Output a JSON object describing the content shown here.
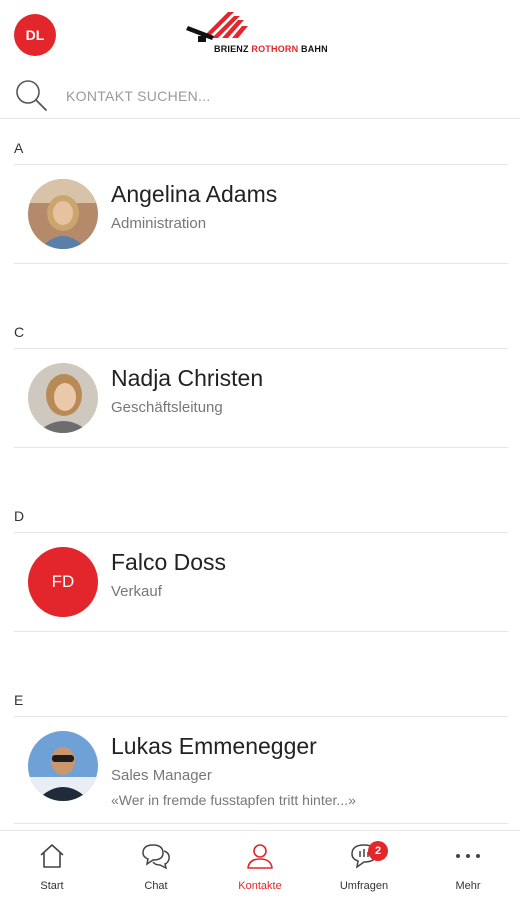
{
  "header": {
    "user_initials": "DL",
    "logo": {
      "part1": "BRIENZ ",
      "part2": "ROTHORN",
      "part3": " BAHN"
    }
  },
  "search": {
    "placeholder": "KONTAKT SUCHEN..."
  },
  "sections": [
    {
      "letter": "A",
      "contact": {
        "name": "Angelina Adams",
        "role": "Administration",
        "status": ""
      }
    },
    {
      "letter": "C",
      "contact": {
        "name": "Nadja Christen",
        "role": "Geschäftsleitung",
        "status": ""
      }
    },
    {
      "letter": "D",
      "contact": {
        "name": "Falco Doss",
        "role": "Verkauf",
        "initials": "FD",
        "status": ""
      }
    },
    {
      "letter": "E",
      "contact": {
        "name": "Lukas Emmenegger",
        "role": "Sales Manager",
        "status": "«Wer in fremde fusstapfen tritt hinter...»"
      }
    }
  ],
  "tabs": [
    {
      "label": "Start",
      "icon": "home-icon"
    },
    {
      "label": "Chat",
      "icon": "chat-icon"
    },
    {
      "label": "Kontakte",
      "icon": "contacts-icon",
      "active": true
    },
    {
      "label": "Umfragen",
      "icon": "surveys-icon",
      "badge": "2"
    },
    {
      "label": "Mehr",
      "icon": "more-icon"
    }
  ],
  "colors": {
    "accent": "#e3262b",
    "divider": "#e6e6e6",
    "text": "#222222",
    "muted": "#777777"
  }
}
